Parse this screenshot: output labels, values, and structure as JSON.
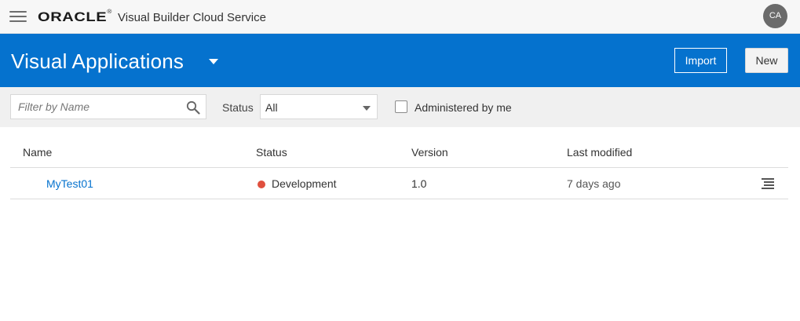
{
  "topbar": {
    "brand": "ORACLE",
    "product": "Visual Builder Cloud Service",
    "avatar_initials": "CA"
  },
  "header": {
    "title": "Visual Applications",
    "import_label": "Import",
    "new_label": "New"
  },
  "filters": {
    "search_placeholder": "Filter by Name",
    "status_label": "Status",
    "status_value": "All",
    "administered_label": "Administered by me",
    "administered_checked": false
  },
  "table": {
    "columns": [
      "Name",
      "Status",
      "Version",
      "Last modified"
    ],
    "rows": [
      {
        "name": "MyTest01",
        "status": "Development",
        "status_color": "#e0503e",
        "version": "1.0",
        "last_modified": "7 days ago"
      }
    ]
  },
  "colors": {
    "accent": "#0572ce",
    "status_development": "#e0503e"
  }
}
